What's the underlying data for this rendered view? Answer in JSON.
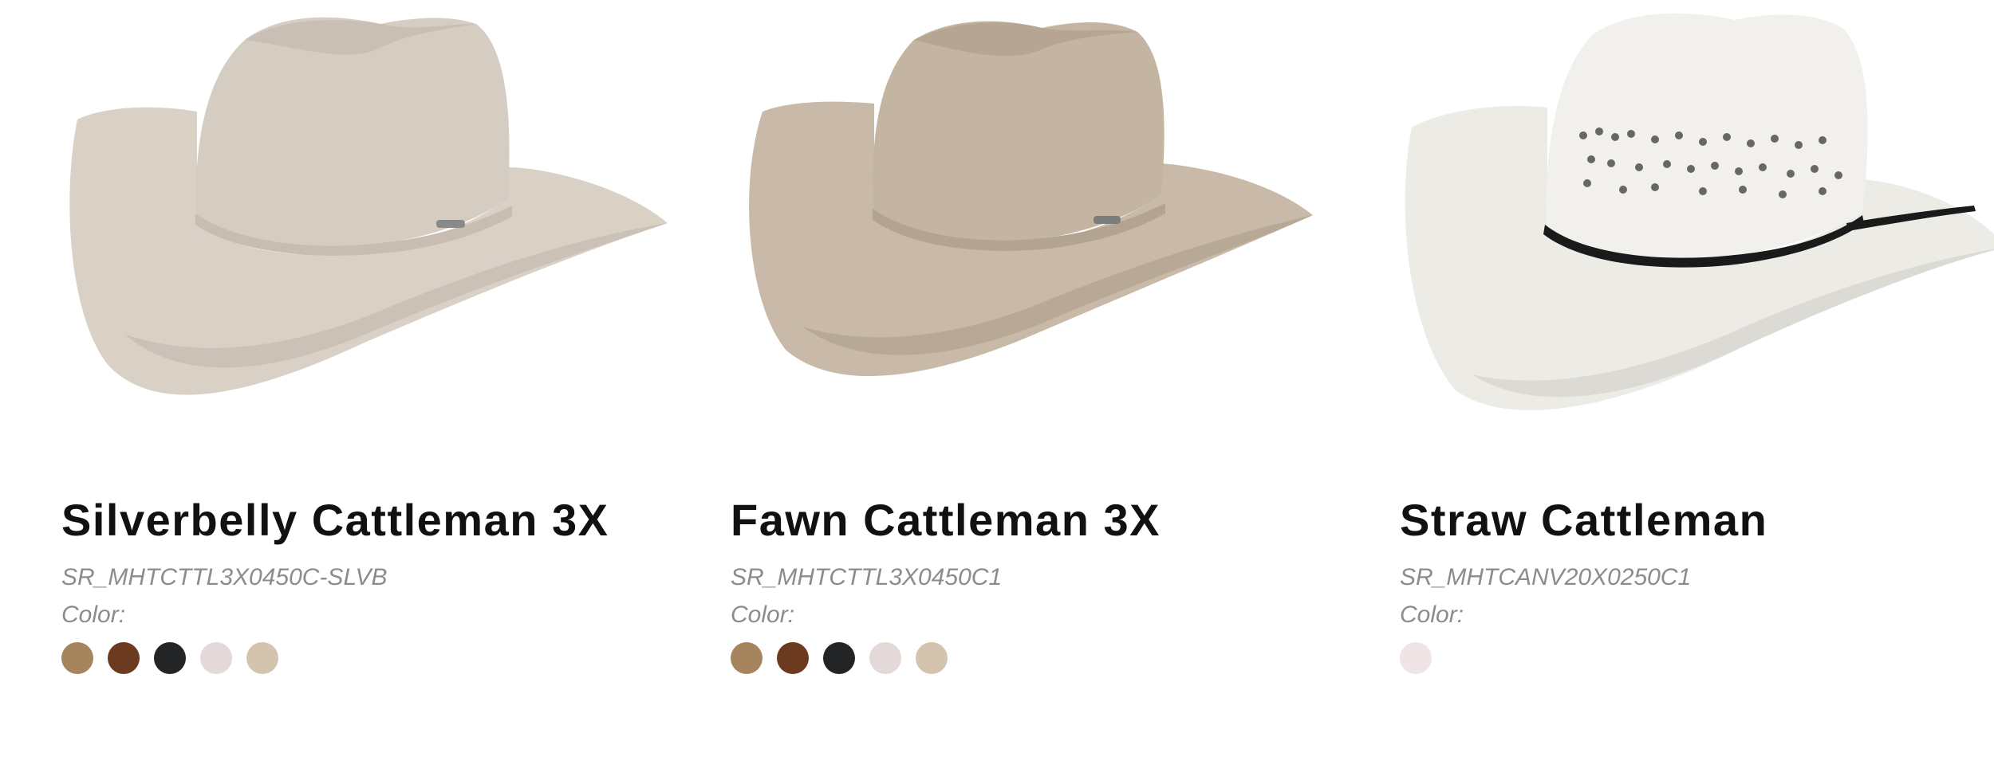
{
  "products": [
    {
      "title": "Silverbelly Cattleman 3X",
      "sku": "SR_MHTCTTL3X0450C-SLVB",
      "color_label": "Color:",
      "image": {
        "icon": "felt-cowboy-hat-image",
        "hat_color": "#d9d0c6",
        "shade_color": "#c8beb3"
      },
      "swatches": [
        {
          "name": "tan",
          "color": "#a5845e"
        },
        {
          "name": "brown",
          "color": "#6b3a1f"
        },
        {
          "name": "black",
          "color": "#222426"
        },
        {
          "name": "silverbelly",
          "color": "#e3d9d8"
        },
        {
          "name": "sand",
          "color": "#d4c3ae"
        }
      ]
    },
    {
      "title": "Fawn Cattleman 3X",
      "sku": "SR_MHTCTTL3X0450C1",
      "color_label": "Color:",
      "image": {
        "icon": "felt-cowboy-hat-image",
        "hat_color": "#c8b9a8",
        "shade_color": "#b3a391"
      },
      "swatches": [
        {
          "name": "tan",
          "color": "#a5845e"
        },
        {
          "name": "brown",
          "color": "#6b3a1f"
        },
        {
          "name": "black",
          "color": "#222426"
        },
        {
          "name": "silverbelly",
          "color": "#e3d9d8"
        },
        {
          "name": "sand",
          "color": "#d4c3ae"
        }
      ]
    },
    {
      "title": "Straw Cattleman",
      "sku": "SR_MHTCANV20X0250C1",
      "color_label": "Color:",
      "image": {
        "icon": "straw-cowboy-hat-image",
        "hat_color": "#ecebe6",
        "shade_color": "#d7d5cf"
      },
      "swatches": [
        {
          "name": "natural",
          "color": "#efe4e6"
        }
      ]
    }
  ]
}
